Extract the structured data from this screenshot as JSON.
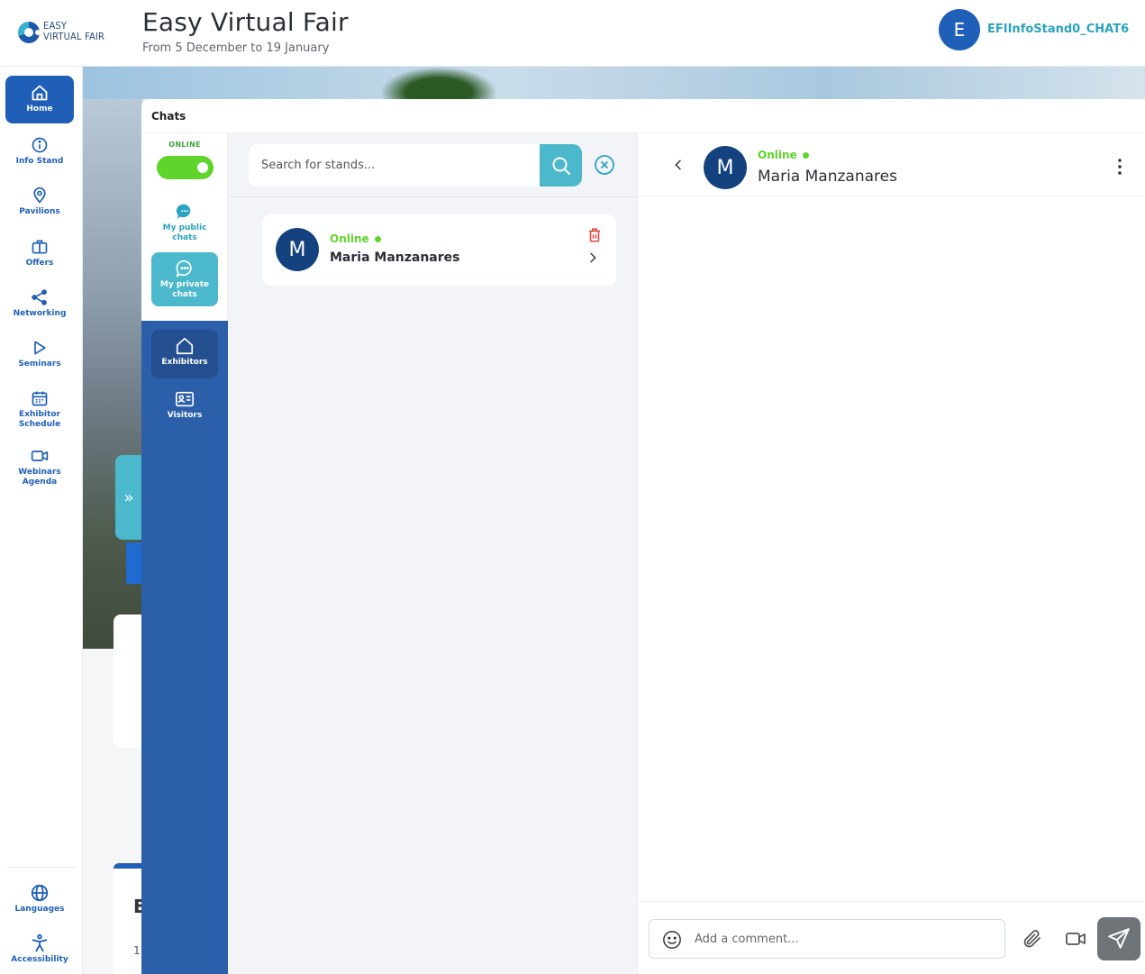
{
  "header": {
    "logo_line1": "EASY",
    "logo_line2": "VIRTUAL FAIR",
    "title": "Easy Virtual Fair",
    "subtitle": "From 5 December to 19 January",
    "user_initial": "E",
    "user_name": "EFIInfoStand0_CHAT6"
  },
  "rail": {
    "items": [
      {
        "label": "Home",
        "icon": "home-icon",
        "active": true
      },
      {
        "label": "Info Stand",
        "icon": "info-icon"
      },
      {
        "label": "Pavilions",
        "icon": "map-pin-icon"
      },
      {
        "label": "Offers",
        "icon": "briefcase-icon"
      },
      {
        "label": "Networking",
        "icon": "share-icon"
      },
      {
        "label": "Seminars",
        "icon": "play-icon"
      },
      {
        "label": "Exhibitor Schedule",
        "icon": "calendar-icon"
      },
      {
        "label": "Webinars Agenda",
        "icon": "video-camera-icon"
      }
    ],
    "bottom": [
      {
        "label": "Languages",
        "icon": "globe-icon"
      },
      {
        "label": "Accessibility",
        "icon": "accessibility-icon"
      }
    ]
  },
  "background": {
    "card_letter": "E",
    "card_number": "1"
  },
  "chats": {
    "panel_title": "Chats",
    "status_label": "ONLINE",
    "status_on": true,
    "nav": {
      "public": "My public chats",
      "private": "My private chats",
      "exhibitors": "Exhibitors",
      "visitors": "Visitors"
    },
    "search": {
      "placeholder": "Search for stands...",
      "value": ""
    },
    "list": [
      {
        "initial": "M",
        "status": "Online",
        "name": "Maria Manzanares"
      }
    ]
  },
  "conversation": {
    "initial": "M",
    "status": "Online",
    "name": "Maria Manzanares",
    "comment_placeholder": "Add a comment..."
  },
  "colors": {
    "primary": "#1f5fb8",
    "accent": "#4bb8cc",
    "online": "#5fd42b",
    "nav_bg": "#2c5faa"
  }
}
